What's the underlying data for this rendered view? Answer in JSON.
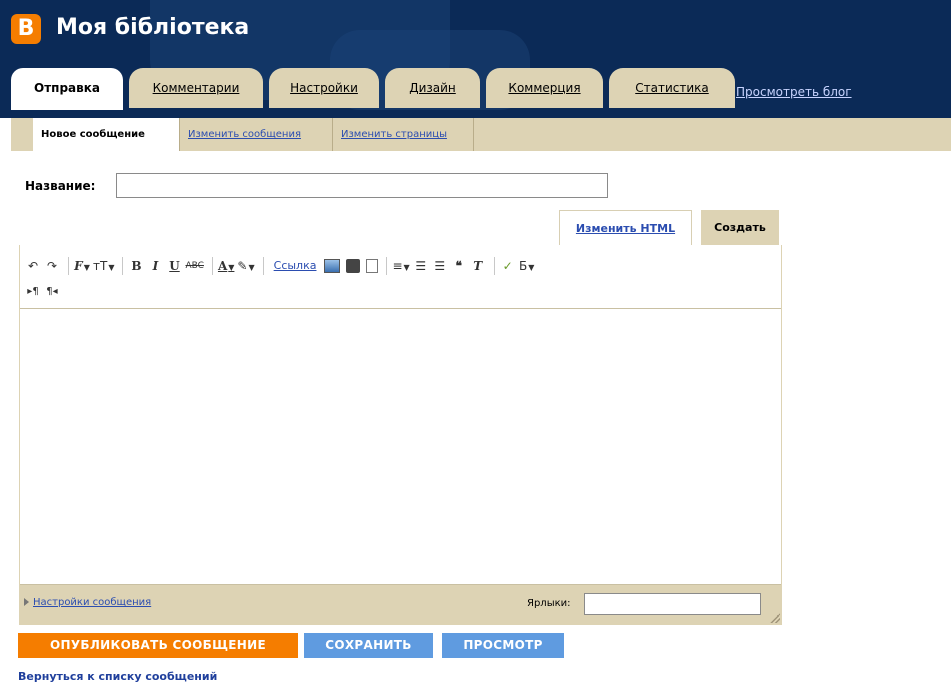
{
  "header": {
    "logo_letter": "B",
    "blog_title": "Моя бібліотека",
    "view_blog": "Просмотреть блог"
  },
  "tabs": [
    {
      "label": "Отправка",
      "active": true
    },
    {
      "label": "Комментарии",
      "active": false
    },
    {
      "label": "Настройки",
      "active": false
    },
    {
      "label": "Дизайн",
      "active": false
    },
    {
      "label": "Коммерция",
      "active": false
    },
    {
      "label": "Статистика",
      "active": false
    }
  ],
  "subnav": [
    {
      "label": "Новое сообщение",
      "active": true
    },
    {
      "label": "Изменить сообщения",
      "active": false
    },
    {
      "label": "Изменить страницы",
      "active": false
    }
  ],
  "form": {
    "title_label": "Название:",
    "title_value": ""
  },
  "editor": {
    "mode_html": "Изменить HTML",
    "mode_create": "Создать",
    "toolbar": {
      "link_label": "Ссылка",
      "bold": "B",
      "italic": "I",
      "underline": "U",
      "strike": "ABC",
      "font": "F",
      "size": "тT",
      "text_color": "A",
      "spell": "Б"
    },
    "post_options": "Настройки сообщения",
    "labels_label": "Ярлыки:",
    "labels_value": ""
  },
  "buttons": {
    "publish": "ОПУБЛИКОВАТЬ СООБЩЕНИЕ",
    "save": "СОХРАНИТЬ",
    "preview": "ПРОСМОТР"
  },
  "back_link": "Вернуться к списку сообщений",
  "colors": {
    "header_bg": "#0b2a57",
    "tab_bg": "#ddd3b4",
    "publish_btn": "#f57d00",
    "secondary_btn": "#5f9be0",
    "link": "#2b4db0"
  }
}
